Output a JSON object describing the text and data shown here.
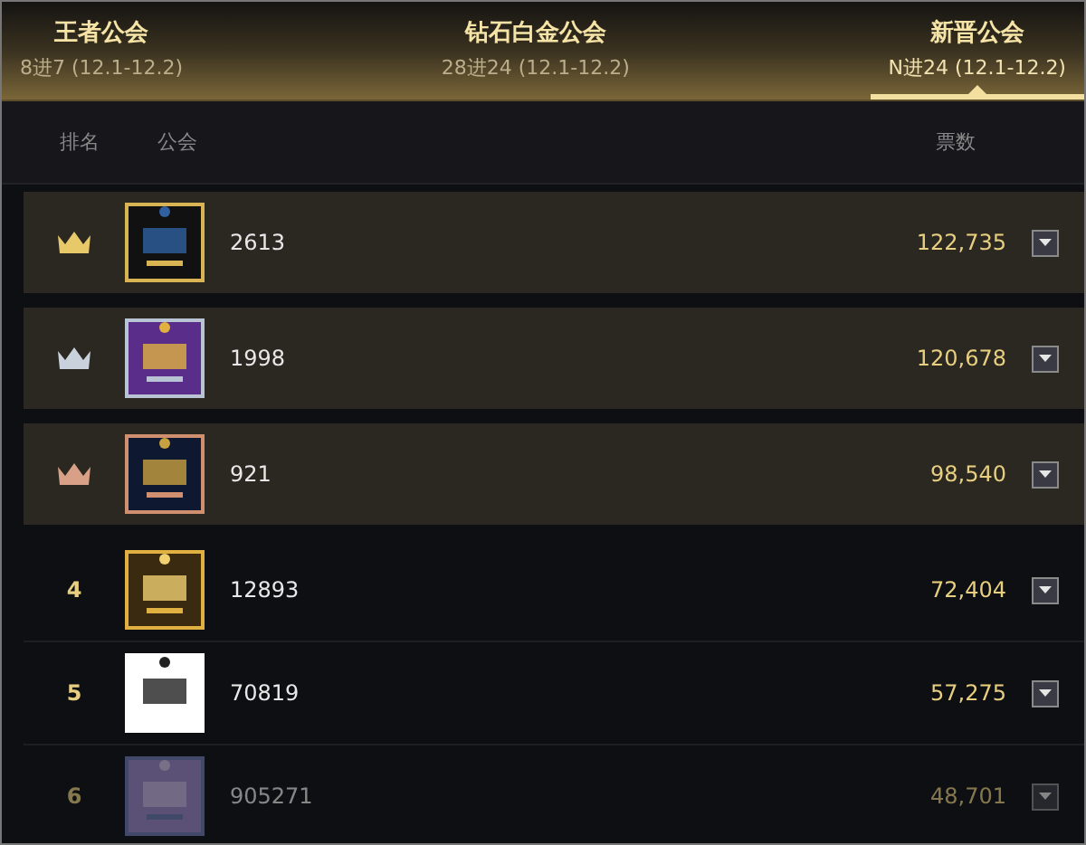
{
  "tabs": [
    {
      "title": "王者公会",
      "subtitle": "8进7 (12.1-12.2)",
      "selected": false
    },
    {
      "title": "钻石白金公会",
      "subtitle": "28进24 (12.1-12.2)",
      "selected": false
    },
    {
      "title": "新晋公会",
      "subtitle": "N进24 (12.1-12.2)",
      "selected": true
    }
  ],
  "columns": [
    "排名",
    "公会",
    "票数"
  ],
  "rows": [
    {
      "kind": "crown",
      "color": "#e8c96a",
      "name": "2613",
      "votes": "122,735",
      "faded": false
    },
    {
      "kind": "crown",
      "color": "#c9d2dc",
      "name": "1998",
      "votes": "120,678",
      "faded": false
    },
    {
      "kind": "crown",
      "color": "#d9a088",
      "name": "921",
      "votes": "98,540",
      "faded": false
    },
    {
      "kind": "number",
      "rank": "4",
      "name": "12893",
      "votes": "72,404",
      "faded": false
    },
    {
      "kind": "number",
      "rank": "5",
      "name": "70819",
      "votes": "57,275",
      "faded": false
    },
    {
      "kind": "number",
      "rank": "6",
      "name": "905271",
      "votes": "48,701",
      "faded": true
    }
  ]
}
